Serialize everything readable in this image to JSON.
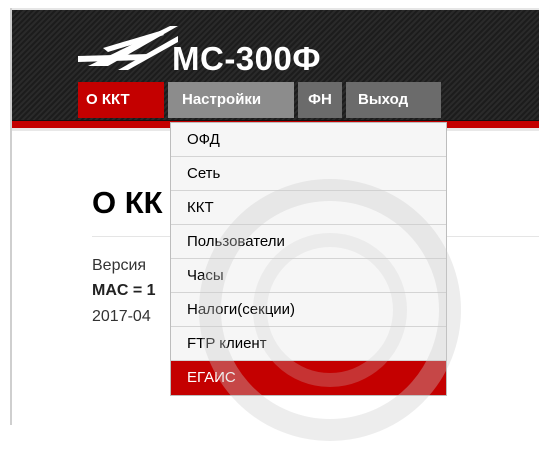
{
  "app": {
    "title": "МС-300Ф"
  },
  "nav": {
    "tabs": [
      {
        "label": "О ККТ",
        "active": true
      },
      {
        "label": "Настройки",
        "active": false
      },
      {
        "label": "ФН",
        "active": false
      },
      {
        "label": "Выход",
        "active": false
      }
    ]
  },
  "page": {
    "title": "О КК",
    "lines": [
      "Версия",
      "MAC = 1",
      "2017-04"
    ]
  },
  "dropdown": {
    "items": [
      {
        "label": "ОФД"
      },
      {
        "label": "Сеть"
      },
      {
        "label": "ККТ"
      },
      {
        "label": "Пользователи"
      },
      {
        "label": "Часы"
      },
      {
        "label": "Налоги(секции)"
      },
      {
        "label": "FTP клиент"
      },
      {
        "label": "ЕГАИС",
        "active": true
      }
    ]
  },
  "colors": {
    "brand_red": "#c40000",
    "header_dark": "#222222",
    "tab_gray": "#8c8c8c",
    "tab_dark_gray": "#6b6b6b"
  }
}
